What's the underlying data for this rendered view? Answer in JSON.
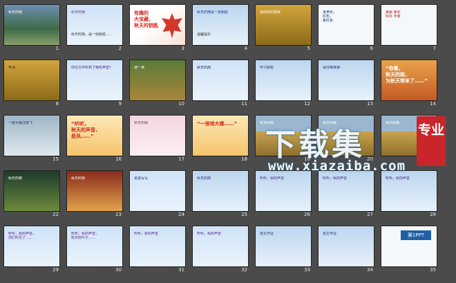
{
  "watermark": {
    "text": "下载集",
    "url": "www.xiazaiba.com",
    "badge": "专业"
  },
  "slides": [
    {
      "n": "1",
      "t": "秋天的雨",
      "sub": ""
    },
    {
      "n": "2",
      "t": "秋天的雨",
      "sub": "秋天的雨，是一把钥匙……"
    },
    {
      "n": "3",
      "t": "有趣的\n大宝藏，\n秋天的钥匙",
      "sub": ""
    },
    {
      "n": "4",
      "t": "秋天的雨是一把钥匙",
      "sub": "温馨提示"
    },
    {
      "n": "5",
      "t": "读出你的感受",
      "sub": ""
    },
    {
      "n": "6",
      "t": "金黄色，\n红色，\n紫红色",
      "sub": ""
    },
    {
      "n": "7",
      "t": "飘飘 争先\n红红 丰收",
      "sub": ""
    },
    {
      "n": "8",
      "t": "字词",
      "sub": ""
    },
    {
      "n": "9",
      "t": "你在文中听到了哪些声音？",
      "sub": ""
    },
    {
      "n": "10",
      "t": "读一读",
      "sub": ""
    },
    {
      "n": "11",
      "t": "秋天的雨",
      "sub": ""
    },
    {
      "n": "12",
      "t": "学习目标",
      "sub": ""
    },
    {
      "n": "13",
      "t": "请仔细读读",
      "sub": ""
    },
    {
      "n": "14",
      "t": "“你看，\n秋天的雨，\n为秋天带来了……”",
      "sub": ""
    },
    {
      "n": "15",
      "t": "一群大雁往南飞",
      "sub": ""
    },
    {
      "n": "16",
      "t": "“听听，\n秋天的声音，\n是风……”",
      "sub": ""
    },
    {
      "n": "17",
      "t": "秋天的雨",
      "sub": ""
    },
    {
      "n": "18",
      "t": "“一排排大雁……”",
      "sub": ""
    },
    {
      "n": "19",
      "t": "秋天的雨",
      "sub": ""
    },
    {
      "n": "20",
      "t": "秋天的雨",
      "sub": ""
    },
    {
      "n": "21",
      "t": "秋天的雨",
      "sub": ""
    },
    {
      "n": "22",
      "t": "秋天的雨",
      "sub": ""
    },
    {
      "n": "23",
      "t": "秋天的雨",
      "sub": ""
    },
    {
      "n": "24",
      "t": "说说写写",
      "sub": ""
    },
    {
      "n": "25",
      "t": "秋天的雨",
      "sub": ""
    },
    {
      "n": "26",
      "t": "听听，秋的声音",
      "sub": ""
    },
    {
      "n": "27",
      "t": "听听，秋的声音",
      "sub": ""
    },
    {
      "n": "28",
      "t": "听听，秋的声音",
      "sub": ""
    },
    {
      "n": "29",
      "t": "听听，秋的声音，\n你们听见了……",
      "sub": ""
    },
    {
      "n": "30",
      "t": "听听，秋的声音，\n秋天的叶子……",
      "sub": ""
    },
    {
      "n": "31",
      "t": "听听，秋的声音",
      "sub": ""
    },
    {
      "n": "32",
      "t": "听听，秋的声音",
      "sub": ""
    },
    {
      "n": "33",
      "t": "自主作业",
      "sub": ""
    },
    {
      "n": "34",
      "t": "自主作业",
      "sub": ""
    },
    {
      "n": "35",
      "t": "第1PPT",
      "sub": ""
    }
  ]
}
